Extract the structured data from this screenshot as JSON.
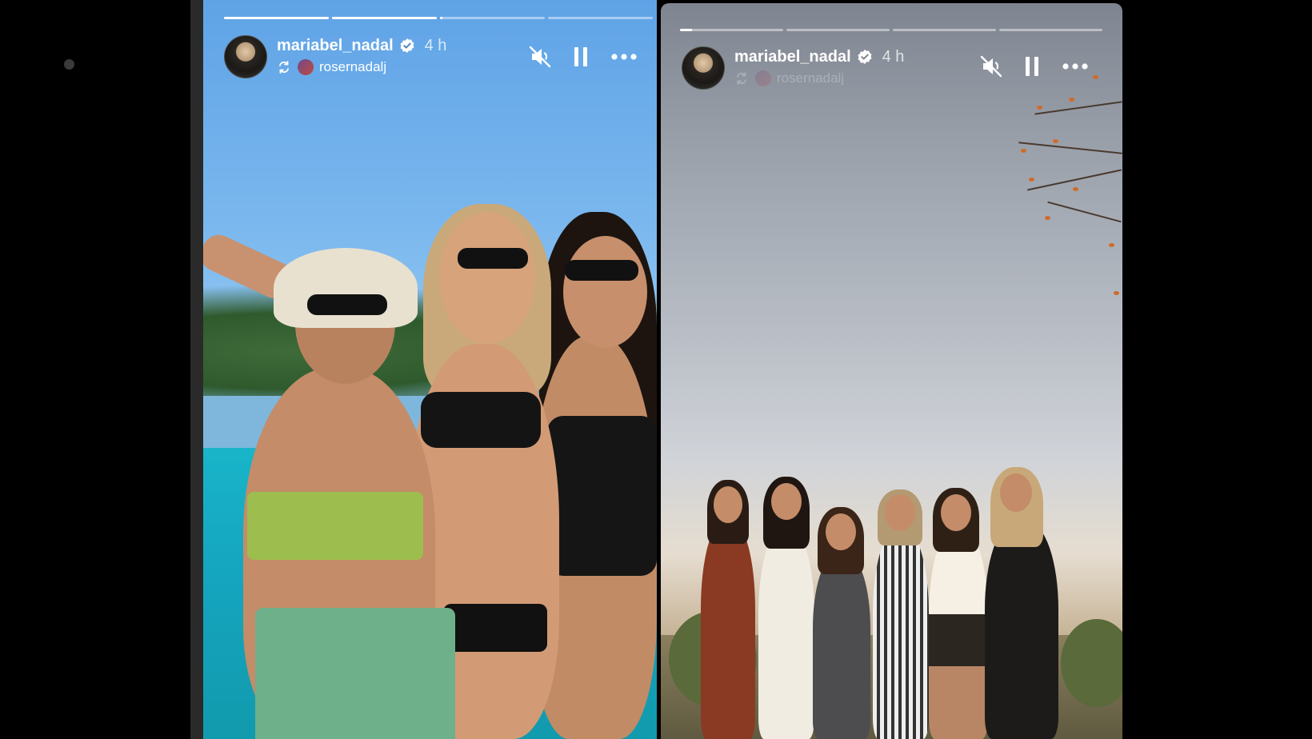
{
  "stories": [
    {
      "username": "mariabel_nadal",
      "time": "4 h",
      "reposted_from": "rosernadalj",
      "progress_segments": [
        1,
        1,
        0.02,
        0
      ]
    },
    {
      "username": "mariabel_nadal",
      "time": "4 h",
      "reposted_from": "rosernadalj",
      "progress_segments": [
        0.12,
        0,
        0,
        0
      ]
    }
  ],
  "icons": {
    "verified": "verified-badge-icon",
    "repost": "repost-icon",
    "mute": "muted-speaker-icon",
    "pause": "pause-icon",
    "more": "more-options-icon"
  },
  "colors": {
    "background": "#000000",
    "progress_fill": "#ffffff",
    "progress_track": "rgba(255,255,255,0.45)"
  }
}
